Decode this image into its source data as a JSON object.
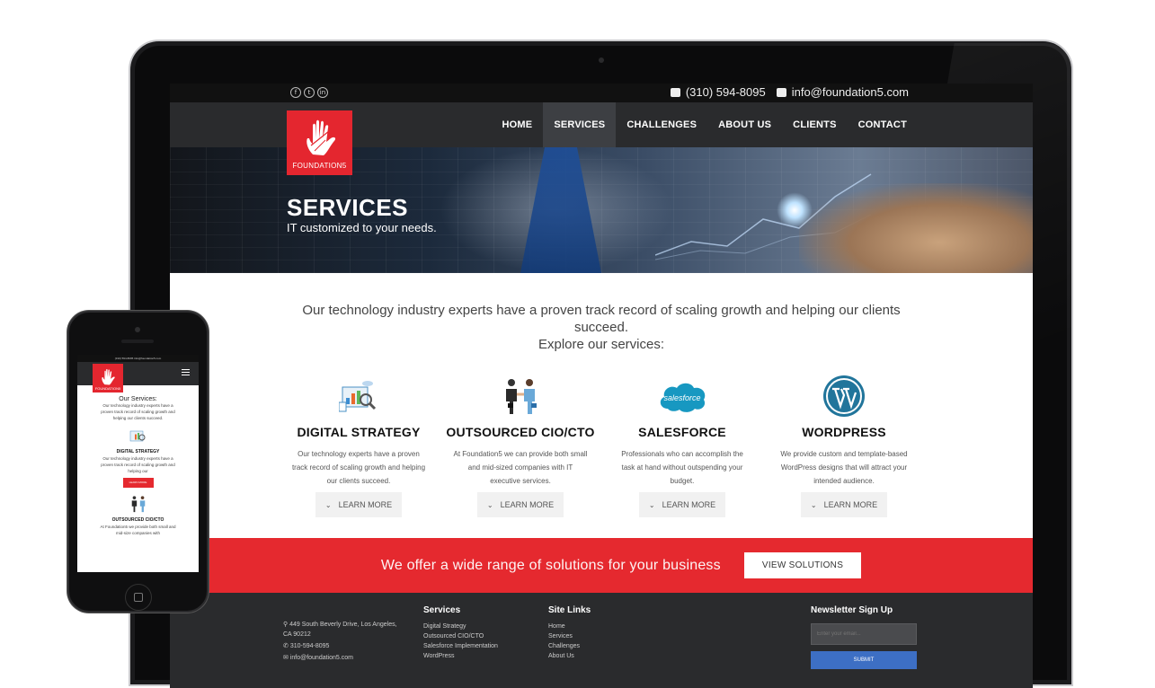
{
  "topbar": {
    "social": [
      "f",
      "t",
      "in"
    ],
    "phone": "(310) 594-8095",
    "email": "info@foundation5.com"
  },
  "logo": {
    "text": "FOUNDATION5"
  },
  "nav": {
    "items": [
      "HOME",
      "SERVICES",
      "CHALLENGES",
      "ABOUT US",
      "CLIENTS",
      "CONTACT"
    ],
    "active": "SERVICES"
  },
  "hero": {
    "title": "SERVICES",
    "subtitle": "IT customized to your needs."
  },
  "intro": {
    "line1": "Our technology industry experts have a proven track record of scaling growth and helping our clients succeed.",
    "line2": "Explore our services:"
  },
  "services": [
    {
      "icon": "analytics-icon",
      "title": "DIGITAL STRATEGY",
      "desc": "Our technology experts have a proven track record of scaling growth and helping our clients succeed.",
      "button": "LEARN MORE"
    },
    {
      "icon": "handshake-icon",
      "title": "OUTSOURCED CIO/CTO",
      "desc": "At Foundation5 we can provide both small and mid-sized companies with IT executive services.",
      "button": "LEARN MORE"
    },
    {
      "icon": "salesforce-icon",
      "title": "SALESFORCE",
      "desc": "Professionals who can accomplish the task at hand without outspending your budget.",
      "button": "LEARN MORE"
    },
    {
      "icon": "wordpress-icon",
      "title": "WORDPRESS",
      "desc": "We provide custom and template-based WordPress designs that will attract your intended audience.",
      "button": "LEARN MORE"
    }
  ],
  "salesforce_logo_text": "salesforce",
  "banner": {
    "text": "We offer a wide range of solutions for your business",
    "button": "VIEW SOLUTIONS"
  },
  "footer": {
    "address": "449 South Beverly Drive, Los Angeles, CA 90212",
    "phone": "310-594-8095",
    "email": "info@foundation5.com",
    "services_title": "Services",
    "services": [
      "Digital Strategy",
      "Outsourced CIO/CTO",
      "Salesforce Implementation",
      "WordPress"
    ],
    "links_title": "Site Links",
    "links": [
      "Home",
      "Services",
      "Challenges",
      "About Us"
    ],
    "newsletter_title": "Newsletter Sign Up",
    "newsletter_placeholder": "Enter your email...",
    "newsletter_button": "SUBMIT"
  },
  "phone_mockup": {
    "topbar": "(310) 594-8095   info@foundation5.com",
    "logo_text": "FOUNDATION5",
    "heading": "Our Services:",
    "intro": "Our technology industry experts have a proven track record of scaling growth and helping our clients succeed.",
    "s1_title": "DIGITAL STRATEGY",
    "s1_desc": "Our technology industry experts have a proven track record of scaling growth and helping our",
    "s1_button": "LEARN MORE",
    "s2_title": "OUTSOURCED CIO/CTO",
    "s2_desc": "At Foundation5 we provide both small and mid-size companies with"
  },
  "colors": {
    "brand_red": "#e4262f",
    "nav_bg": "#2a2b2d",
    "newsletter_button": "#3d6fc4",
    "wordpress_blue": "#21759b",
    "salesforce_blue": "#1798c1"
  }
}
